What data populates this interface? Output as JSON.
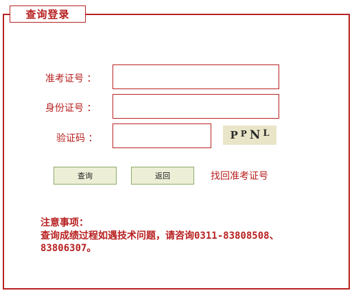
{
  "legend": "查询登录",
  "form": {
    "exam_number_label": "准考证号 ：",
    "exam_number_value": "",
    "id_number_label": "身份证号 ：",
    "id_number_value": "",
    "captcha_label": "验证码 ：",
    "captcha_value": ""
  },
  "captcha_image": {
    "chars": [
      "P",
      "P",
      "N",
      "L"
    ]
  },
  "buttons": {
    "query": "查询",
    "back": "返回"
  },
  "find_link": "找回准考证号",
  "notice": {
    "title": "注意事项：",
    "line1": "查询成绩过程如遇技术问题，请咨询0311-83808508、",
    "line2": "83806307。"
  },
  "colors": {
    "accent": "#b82020",
    "button_bg": "#ecefd6"
  }
}
